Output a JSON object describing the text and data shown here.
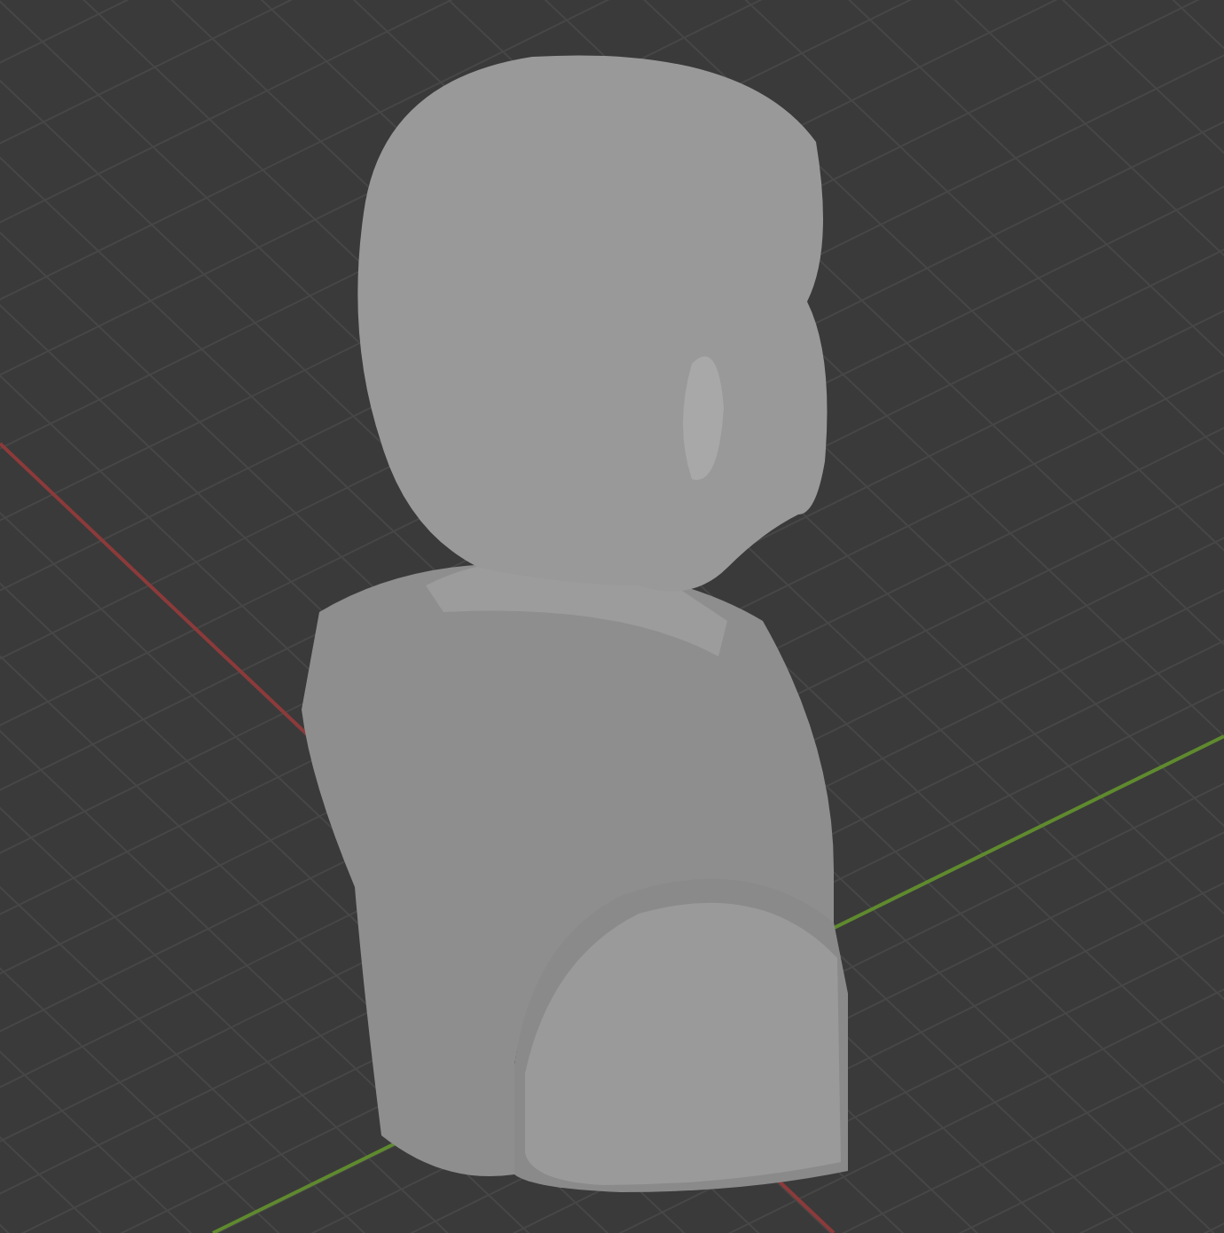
{
  "viewport": {
    "grid": true,
    "axes": [
      {
        "kind": "x",
        "color": "#8c3a3a"
      },
      {
        "kind": "y",
        "color": "#5f8a2e"
      }
    ]
  }
}
